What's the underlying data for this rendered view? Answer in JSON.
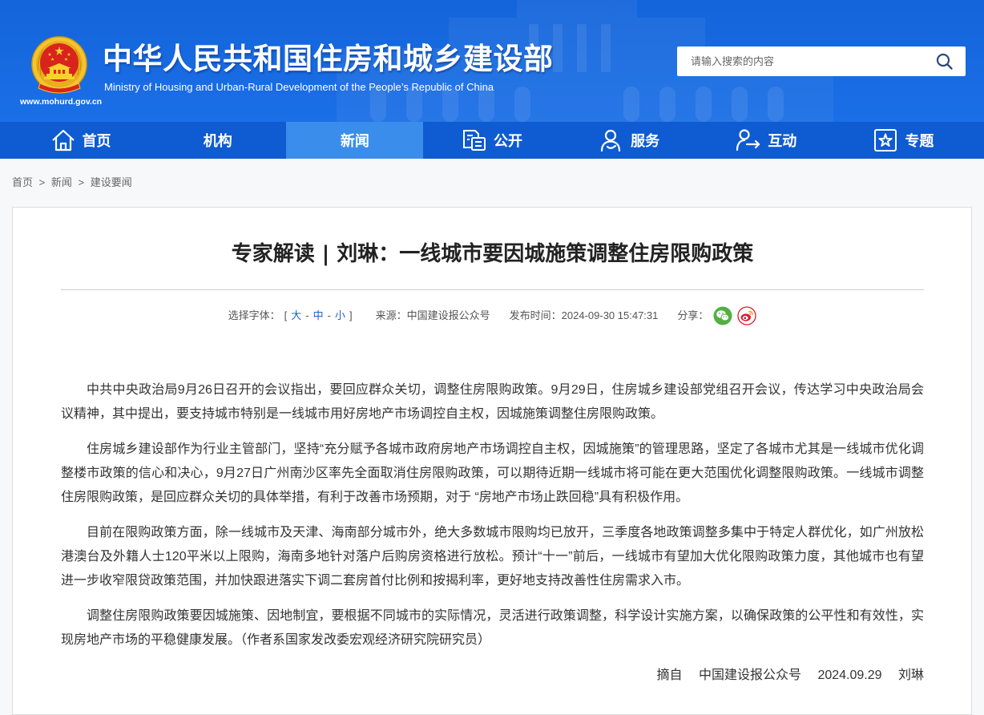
{
  "site": {
    "title": "中华人民共和国住房和城乡建设部",
    "subtitle": "Ministry of Housing and Urban-Rural Development of the People’s Republic of China",
    "url": "www.mohurd.gov.cn",
    "logo_icon": "national-emblem"
  },
  "search": {
    "placeholder": "请输入搜索的内容",
    "icon": "search-icon"
  },
  "nav": {
    "items": [
      {
        "label": "首页",
        "icon": "home-icon"
      },
      {
        "label": "机构"
      },
      {
        "label": "新闻",
        "active": true
      },
      {
        "label": "公开",
        "icon": "document-icon"
      },
      {
        "label": "服务",
        "icon": "service-icon"
      },
      {
        "label": "互动",
        "icon": "interaction-icon"
      },
      {
        "label": "专题",
        "icon": "topic-star-icon"
      }
    ]
  },
  "breadcrumb": {
    "items": [
      "首页",
      "新闻",
      "建设要闻"
    ],
    "separator": ">"
  },
  "article": {
    "title": "专家解读 | 刘琳：一线城市要因城施策调整住房限购政策",
    "meta": {
      "font_label": "选择字体：",
      "font_open": "[",
      "font_sizes": [
        "大",
        "中",
        "小"
      ],
      "font_sep": "-",
      "font_close": "]",
      "source_label": "来源：",
      "source": "中国建设报公众号",
      "published_label": "发布时间：",
      "published": "2024-09-30 15:47:31",
      "share_label": "分享：",
      "share_icons": [
        "wechat-icon",
        "weibo-icon"
      ]
    },
    "paragraphs": [
      "中共中央政治局9月26日召开的会议指出，要回应群众关切，调整住房限购政策。9月29日，住房城乡建设部党组召开会议，传达学习中央政治局会议精神，其中提出，要支持城市特别是一线城市用好房地产市场调控自主权，因城施策调整住房限购政策。",
      "住房城乡建设部作为行业主管部门，坚持“充分赋予各城市政府房地产市场调控自主权，因城施策”的管理思路，坚定了各城市尤其是一线城市优化调整楼市政策的信心和决心，9月27日广州南沙区率先全面取消住房限购政策，可以期待近期一线城市将可能在更大范围优化调整限购政策。一线城市调整住房限购政策，是回应群众关切的具体举措，有利于改善市场预期，对于 “房地产市场止跌回稳”具有积极作用。",
      "目前在限购政策方面，除一线城市及天津、海南部分城市外，绝大多数城市限购均已放开，三季度各地政策调整多集中于特定人群优化，如广州放松港澳台及外籍人士120平米以上限购，海南多地针对落户后购房资格进行放松。预计“十一”前后，一线城市有望加大优化限购政策力度，其他城市也有望进一步收窄限贷政策范围，并加快跟进落实下调二套房首付比例和按揭利率，更好地支持改善性住房需求入市。",
      "调整住房限购政策要因城施策、因地制宜，要根据不同城市的实际情况，灵活进行政策调整，科学设计实施方案，以确保政策的公平性和有效性，实现房地产市场的平稳健康发展。（作者系国家发改委宏观经济研究院研究员）"
    ],
    "signature": {
      "prefix": "摘自",
      "source": "中国建设报公众号",
      "date": "2024.09.29",
      "author": "刘琳"
    }
  },
  "colors": {
    "header_blue": "#1b6fe6",
    "nav_blue": "#0f5bd1",
    "nav_active": "#3b8deb",
    "link_blue": "#1f63c6",
    "wechat_green": "#52b043",
    "weibo_red": "#e6162d",
    "emblem_gold": "#f4c431",
    "emblem_red": "#d8241c"
  }
}
